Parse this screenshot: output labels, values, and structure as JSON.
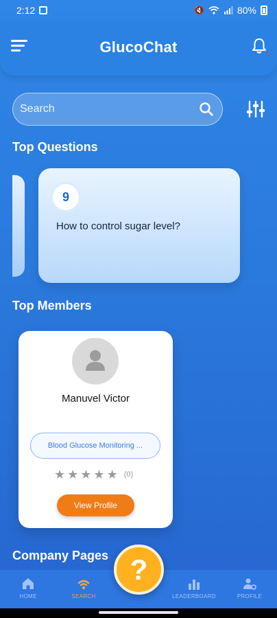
{
  "status_bar": {
    "time": "2:12",
    "battery": "80%"
  },
  "header": {
    "title": "GlucoChat"
  },
  "search": {
    "placeholder": "Search"
  },
  "sections": {
    "top_questions": "Top Questions",
    "top_members": "Top Members",
    "company_pages": "Company Pages"
  },
  "questions": [
    {
      "number": "9",
      "text": "How to control sugar level?"
    }
  ],
  "members": [
    {
      "name": "Manuvel Victor",
      "tag": "Blood Glucose Monitoring ...",
      "rating_count": "(0)",
      "rating_stars": 0,
      "view_label": "View Profile"
    }
  ],
  "bottom_nav": {
    "items": [
      {
        "label": "HOME",
        "icon": "home-icon"
      },
      {
        "label": "SEARCH",
        "icon": "search-nav-icon",
        "active": true
      },
      {
        "label": "LEADERBOARD",
        "icon": "leaderboard-icon"
      },
      {
        "label": "PROFILE",
        "icon": "profile-icon"
      }
    ],
    "fab_symbol": "?"
  },
  "colors": {
    "background": "#2b7fe0",
    "accent": "#f07c17",
    "fab": "#ffb11f"
  }
}
